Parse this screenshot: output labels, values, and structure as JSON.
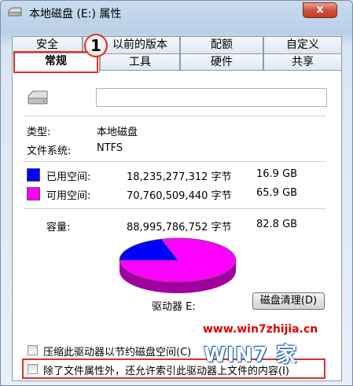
{
  "window": {
    "title": "本地磁盘 (E:) 属性",
    "close_glyph": "x"
  },
  "tabs_top": [
    {
      "label": "安全"
    },
    {
      "label": "以前的版本"
    },
    {
      "label": "配额"
    },
    {
      "label": "自定义"
    }
  ],
  "tabs_bottom": [
    {
      "label": "常规"
    },
    {
      "label": "工具"
    },
    {
      "label": "硬件"
    },
    {
      "label": "共享"
    }
  ],
  "callout": "1",
  "general": {
    "label_value": "",
    "type_label": "类型:",
    "type_value": "本地磁盘",
    "fs_label": "文件系统:",
    "fs_value": "NTFS",
    "used": {
      "label": "已用空间:",
      "bytes": "18,235,277,312 字节",
      "size": "16.9 GB",
      "color": "#0000ff"
    },
    "free": {
      "label": "可用空间:",
      "bytes": "70,760,509,440 字节",
      "size": "65.9 GB",
      "color": "#ff00ff"
    },
    "capacity": {
      "label": "容量:",
      "bytes": "88,995,786,752 字节",
      "size": "82.8 GB"
    },
    "drive_label": "驱动器 E:",
    "cleanup_button": "磁盘清理(D)",
    "compress_option": "压缩此驱动器以节约磁盘空间(C)",
    "index_option": "除了文件属性外，还允许索引此驱动器上文件的内容(I)",
    "used_fraction": 0.205
  },
  "watermark": {
    "url": "www.win7zhijia.cn",
    "logo": "WIN7 家"
  }
}
